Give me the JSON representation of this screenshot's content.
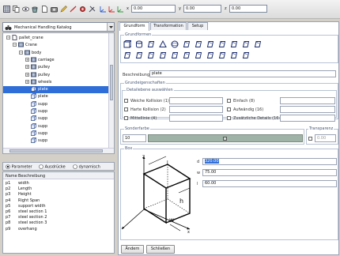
{
  "toolbar": {
    "x_label": "x",
    "x_value": "0.00",
    "y_label": "y",
    "y_value": "0.00",
    "z_label": "z",
    "z_value": "0.00"
  },
  "catalog": {
    "selected": "Mechanical Handling Katalog"
  },
  "tree": {
    "items": [
      {
        "label": "pallet_crane",
        "level": 0,
        "icon": "document-icon"
      },
      {
        "label": "Crane",
        "level": 1,
        "icon": "part-icon"
      },
      {
        "label": "body",
        "level": 2,
        "icon": "part-icon"
      },
      {
        "label": "carriage",
        "level": 3,
        "icon": "part-icon"
      },
      {
        "label": "pulley",
        "level": 3,
        "icon": "part-icon"
      },
      {
        "label": "pulley",
        "level": 3,
        "icon": "part-icon"
      },
      {
        "label": "wheels",
        "level": 3,
        "icon": "part-icon"
      },
      {
        "label": "plate",
        "level": 3,
        "icon": "box-icon",
        "selected": true
      },
      {
        "label": "plate",
        "level": 3,
        "icon": "box-icon"
      },
      {
        "label": "supp",
        "level": 3,
        "icon": "box-icon"
      },
      {
        "label": "supp",
        "level": 3,
        "icon": "box-icon"
      },
      {
        "label": "supp",
        "level": 3,
        "icon": "box-icon"
      },
      {
        "label": "supp",
        "level": 3,
        "icon": "box-icon"
      },
      {
        "label": "supp",
        "level": 3,
        "icon": "box-icon"
      },
      {
        "label": "supp",
        "level": 3,
        "icon": "box-icon"
      }
    ]
  },
  "param_mode": {
    "options": [
      "Parameter",
      "Ausdrücke",
      "dynamisch"
    ],
    "selected": "Parameter"
  },
  "params": {
    "headers": [
      "Name",
      "Beschreibung"
    ],
    "rows": [
      [
        "p1",
        "width"
      ],
      [
        "p2",
        "Length"
      ],
      [
        "p3",
        "Height"
      ],
      [
        "p4",
        "Right Span"
      ],
      [
        "p5",
        "support width"
      ],
      [
        "p6",
        "steel section 1"
      ],
      [
        "p7",
        "steel section 2"
      ],
      [
        "p8",
        "steel section 3"
      ],
      [
        "p9",
        "overhang"
      ]
    ]
  },
  "tabs": [
    "Grundform",
    "Transformation",
    "Setup"
  ],
  "active_tab": "Grundform",
  "grundformen": {
    "title": "Grundformen"
  },
  "beschreibung": {
    "label": "Beschreibung",
    "value": "plate"
  },
  "grundeigenschaften": {
    "title": "Grundeigenschaften",
    "detail_title": "Detailebene auswählen",
    "options": [
      "Weiche Kollision (1)",
      "Einfach (8)",
      "Harte Kollision (2)",
      "Aufwändig (16)",
      "Mittellinie (4)",
      "Zusätzliche Details (16+)"
    ]
  },
  "sonderfarbe": {
    "title": "Sonderfarbe",
    "value": "10"
  },
  "transparenz": {
    "title": "Transparenz",
    "value": "0.00"
  },
  "box": {
    "title": "Box",
    "d_label": "d",
    "d_value": "320.00",
    "w_label": "w",
    "w_value": "75.00",
    "h_label": "l",
    "h_value": "60.00",
    "diagram_labels": [
      "z",
      "l",
      "h",
      "w",
      "x"
    ]
  },
  "buttons": {
    "apply": "Ändern",
    "close": "Schließen"
  },
  "colors": {
    "selection": "#2f6ed8",
    "panel_border": "#9aa4b4",
    "section_title": "#4a5a78"
  }
}
